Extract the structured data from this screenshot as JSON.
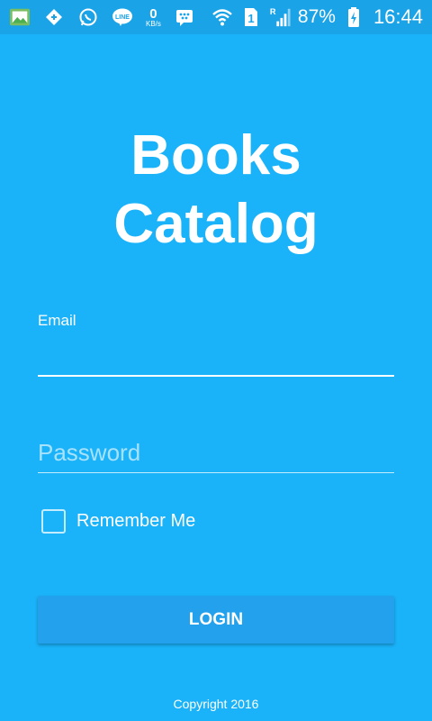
{
  "status_bar": {
    "data_rate": "0",
    "data_rate_unit": "KB/s",
    "sim_number": "1",
    "roaming_indicator": "R",
    "battery_percent": "87%",
    "time": "16:44",
    "icons": [
      "gallery-icon",
      "app-notification-icon",
      "whatsapp-icon",
      "line-icon",
      "bbm-icon",
      "wifi-icon",
      "sim-icon",
      "signal-icon",
      "battery-charging-icon"
    ]
  },
  "app": {
    "title_line1": "Books",
    "title_line2": "Catalog"
  },
  "form": {
    "email_label": "Email",
    "email_value": "",
    "password_placeholder": "Password",
    "remember_label": "Remember Me",
    "remember_checked": false,
    "login_label": "LOGIN"
  },
  "footer": {
    "copyright": "Copyright 2016"
  },
  "colors": {
    "background": "#1ab2f8",
    "status_bar": "#1aa3e6",
    "button": "#23a1ec",
    "text": "#ffffff"
  }
}
